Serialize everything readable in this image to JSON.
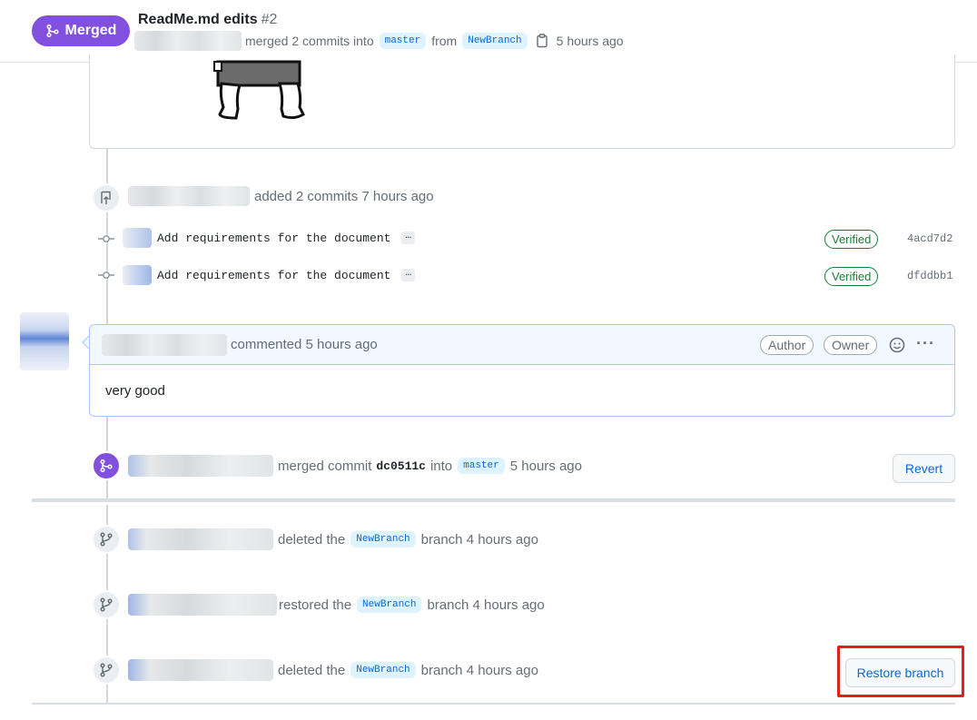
{
  "header": {
    "status": "Merged",
    "title": "ReadMe.md edits",
    "number": "#2",
    "meta_merged": "merged 2 commits into",
    "base_branch": "master",
    "meta_from": "from",
    "head_branch": "NewBranch",
    "time": "5 hours ago"
  },
  "commits_event": {
    "text": "added 2 commits 7 hours ago",
    "commits": [
      {
        "message": "Add requirements for the document",
        "ellipsis": "…",
        "verified": "Verified",
        "sha": "4acd7d2"
      },
      {
        "message": "Add requirements for the document",
        "ellipsis": "…",
        "verified": "Verified",
        "sha": "dfddbb1"
      }
    ]
  },
  "comment": {
    "action": "commented 5 hours ago",
    "badge_author": "Author",
    "badge_owner": "Owner",
    "more": "···",
    "body": "very good"
  },
  "merge_event": {
    "text_before": "merged commit",
    "sha": "dc0511c",
    "text_into": "into",
    "branch": "master",
    "time": "5 hours ago",
    "revert_label": "Revert"
  },
  "branch_events": [
    {
      "action": "deleted the",
      "branch": "NewBranch",
      "suffix": "branch 4 hours ago"
    },
    {
      "action": "restored the",
      "branch": "NewBranch",
      "suffix": "branch 4 hours ago"
    },
    {
      "action": "deleted the",
      "branch": "NewBranch",
      "suffix": "branch 4 hours ago"
    }
  ],
  "restore_branch_label": "Restore branch",
  "colors": {
    "merged": "#8250df",
    "link": "#0969da",
    "verified": "#1a7f37",
    "highlight": "#e0201a"
  }
}
